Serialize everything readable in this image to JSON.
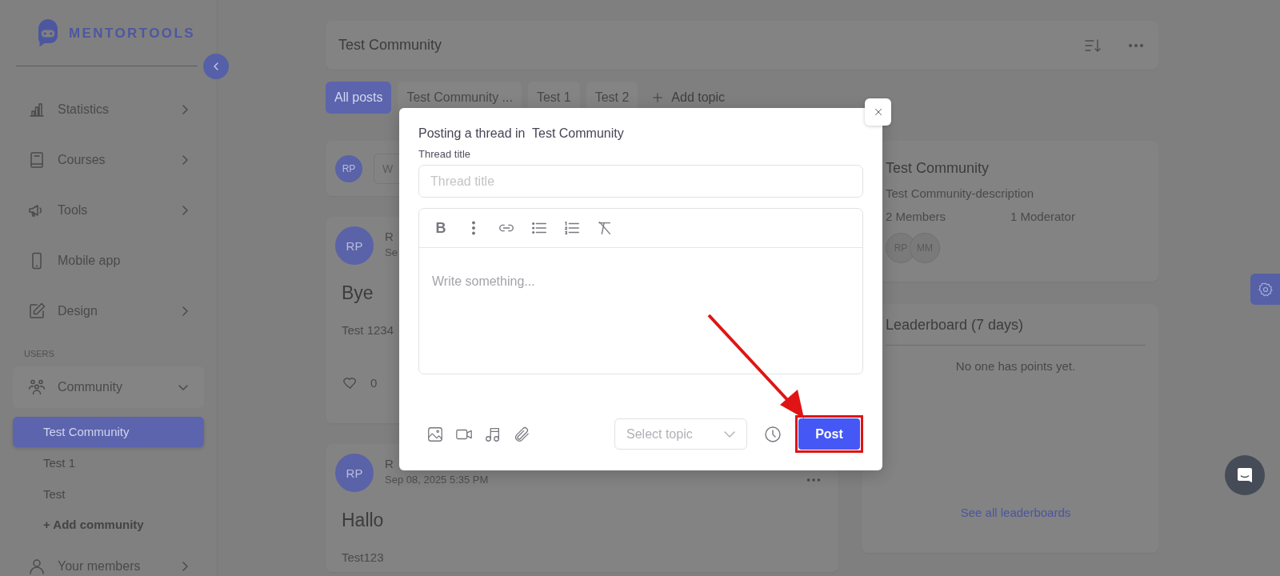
{
  "sidebar": {
    "logo": "MENTORTOOLS",
    "nav": [
      {
        "kind": "menu",
        "label": "Statistics",
        "expanded": false
      },
      {
        "kind": "menu",
        "label": "Courses",
        "expanded": false
      },
      {
        "kind": "menu",
        "label": "Tools",
        "expanded": false
      },
      {
        "kind": "link",
        "label": "Mobile app"
      },
      {
        "kind": "menu",
        "label": "Design",
        "expanded": false
      }
    ],
    "users_section": {
      "heading": "USERS",
      "items": [
        {
          "kind": "menu",
          "label": "Community",
          "expanded": true,
          "children": [
            {
              "label": "Test Community",
              "selected": true
            },
            {
              "label": "Test 1",
              "selected": false
            },
            {
              "label": "Test",
              "selected": false
            }
          ],
          "add_label": "+ Add community"
        },
        {
          "kind": "menu",
          "label": "Your members",
          "expanded": false
        }
      ]
    }
  },
  "header": {
    "title": "Test Community"
  },
  "topics": {
    "tabs": [
      {
        "label": "All posts",
        "selected": true
      },
      {
        "label": "Test Community ...",
        "selected": false
      },
      {
        "label": "Test 1",
        "selected": false
      },
      {
        "label": "Test 2",
        "selected": false
      }
    ],
    "add_label": "Add topic"
  },
  "composer": {
    "avatar": "RP",
    "placeholder": "W"
  },
  "posts": [
    {
      "avatar": "RP",
      "author": "R",
      "date": "Se",
      "title": "Bye",
      "body": "Test 1234",
      "likes": "0"
    },
    {
      "avatar": "RP",
      "author": "R",
      "date": "Sep 08, 2025 5:35 PM",
      "title": "Hallo",
      "body": "Test123"
    }
  ],
  "community": {
    "title": "Test Community",
    "description": "Test Community-description",
    "members": "2 Members",
    "moderators": "1 Moderator",
    "member_avatars": [
      "RP",
      "MM"
    ]
  },
  "leaderboard": {
    "title": "Leaderboard (7 days)",
    "empty": "No one has points yet.",
    "link": "See all leaderboards"
  },
  "modal": {
    "title": "Posting a thread in  Test Community",
    "field_label": "Thread title",
    "title_placeholder": "Thread title",
    "bold_tool": "B",
    "editor_placeholder": "Write something...",
    "topic_placeholder": "Select topic",
    "submit": "Post"
  },
  "annotation": {
    "arrow_to_submit": true,
    "highlight_submit": true
  }
}
